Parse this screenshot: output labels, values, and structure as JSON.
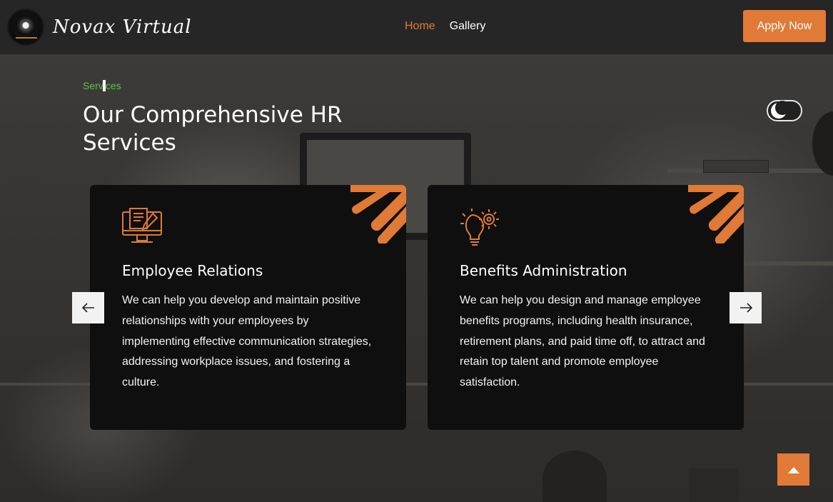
{
  "header": {
    "logo_text": "Novax Virtual",
    "nav": [
      {
        "label": "Home",
        "active": true
      },
      {
        "label": "Gallery",
        "active": false
      }
    ],
    "apply_label": "Apply Now"
  },
  "section": {
    "eyebrow": "Services",
    "title": "Our Comprehensive HR Services"
  },
  "cards": [
    {
      "icon": "computer-document-icon",
      "title": "Employee Relations",
      "text": "We can help you develop and maintain positive relationships with your employees by implementing effective communication strategies, addressing workplace issues, and fostering a culture."
    },
    {
      "icon": "lightbulb-gear-icon",
      "title": "Benefits Administration",
      "text": "We can help you design and manage employee benefits programs, including health insurance, retirement plans, and paid time off, to attract and retain top talent and promote employee satisfaction."
    }
  ],
  "colors": {
    "accent": "#e07a36",
    "eyebrow": "#58c34a",
    "card_bg": "#0f0f0f",
    "header_bg": "#262626"
  }
}
